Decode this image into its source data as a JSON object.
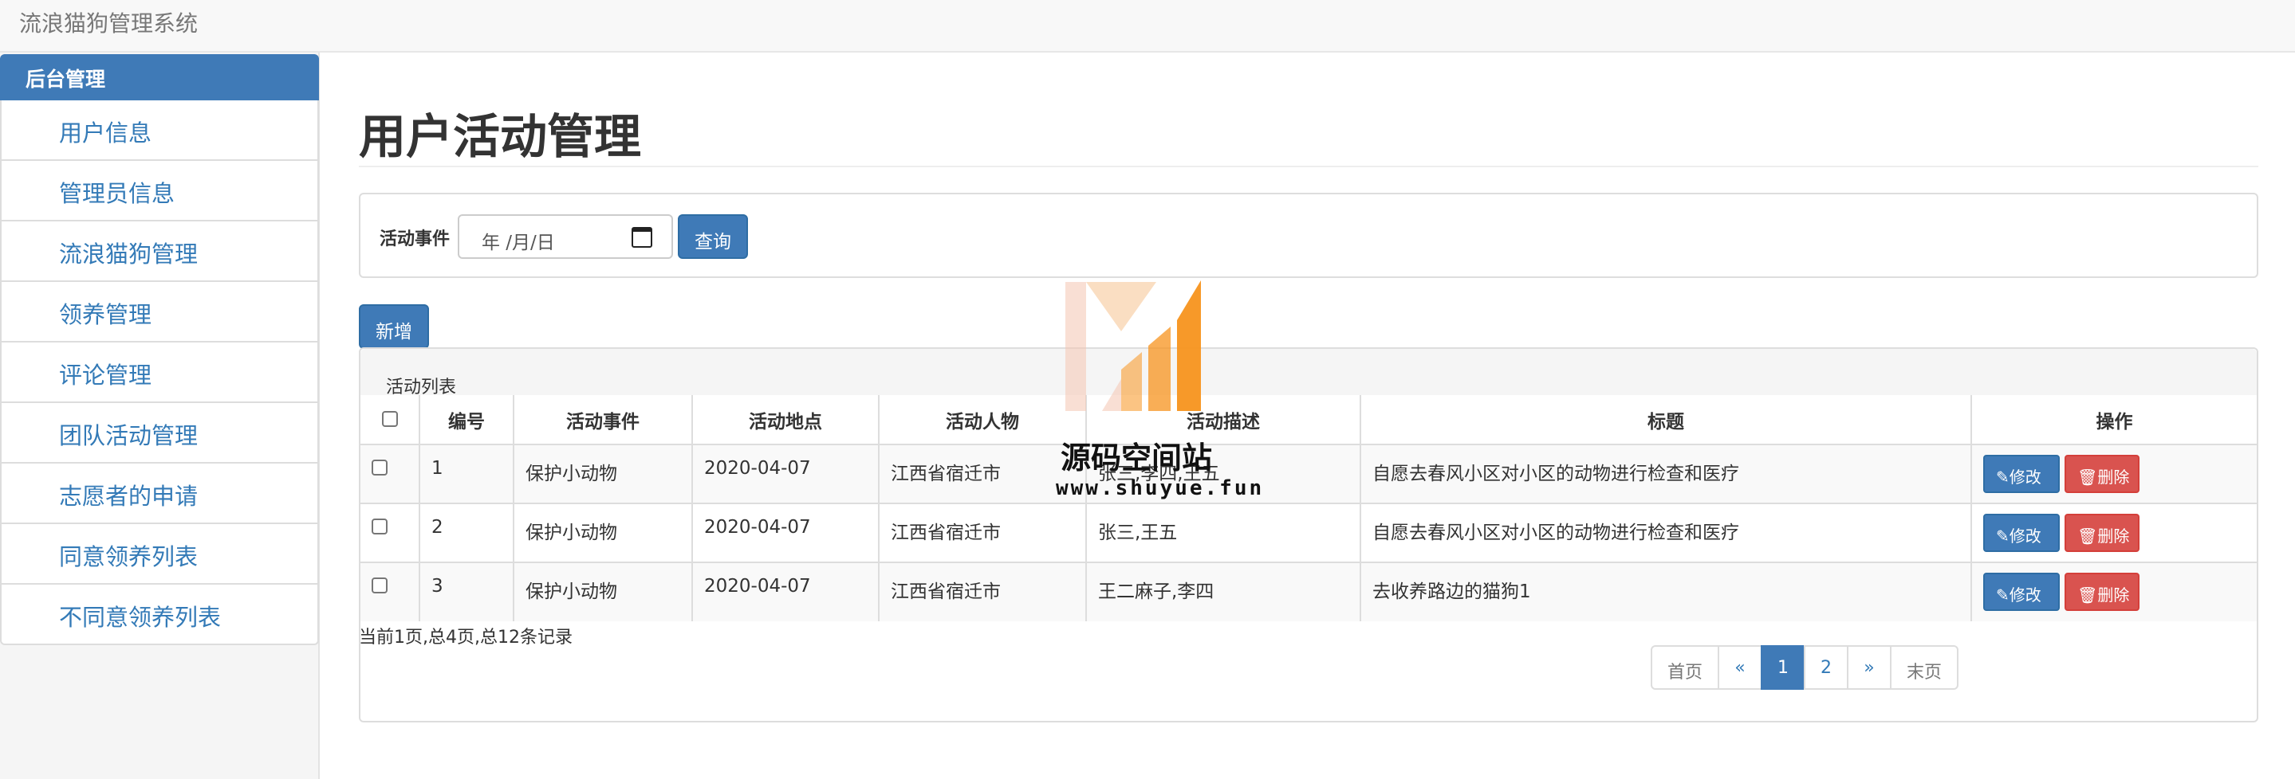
{
  "app": {
    "title": "流浪猫狗管理系统"
  },
  "sidebar": {
    "header": "后台管理",
    "items": [
      {
        "label": "用户信息"
      },
      {
        "label": "管理员信息"
      },
      {
        "label": "流浪猫狗管理"
      },
      {
        "label": "领养管理"
      },
      {
        "label": "评论管理"
      },
      {
        "label": "团队活动管理"
      },
      {
        "label": "志愿者的申请"
      },
      {
        "label": "同意领养列表"
      },
      {
        "label": "不同意领养列表"
      }
    ]
  },
  "main": {
    "title": "用户活动管理",
    "search": {
      "label": "活动事件",
      "date_placeholder": "年 /月/日",
      "button": "查询"
    },
    "add_button": "新增",
    "list": {
      "heading": "活动列表",
      "columns": [
        "编号",
        "活动事件",
        "活动地点",
        "活动人物",
        "活动描述",
        "标题",
        "操作"
      ],
      "rows": [
        {
          "id": "1",
          "event": "保护小动物",
          "place": "2020-04-07",
          "people": "江西省宿迁市",
          "desc": "张三,李四,王五",
          "title": "自愿去春风小区对小区的动物进行检查和医疗"
        },
        {
          "id": "2",
          "event": "保护小动物",
          "place": "2020-04-07",
          "people": "江西省宿迁市",
          "desc": "张三,王五",
          "title": "自愿去春风小区对小区的动物进行检查和医疗"
        },
        {
          "id": "3",
          "event": "保护小动物",
          "place": "2020-04-07",
          "people": "江西省宿迁市",
          "desc": "王二麻子,李四",
          "title": "去收养路边的猫狗1"
        }
      ],
      "edit_label": "修改",
      "delete_label": "删除"
    },
    "summary": "当前1页,总4页,总12条记录",
    "pagination": {
      "first": "首页",
      "prev": "«",
      "pages": [
        "1",
        "2"
      ],
      "current": "1",
      "next": "»",
      "last": "末页"
    }
  },
  "watermark": {
    "name": "源码空间站",
    "url": "www.shuyue.fun"
  },
  "colors": {
    "primary": "#3f7ab7",
    "danger": "#d9534f",
    "watermark_orange": "#f7931e"
  }
}
